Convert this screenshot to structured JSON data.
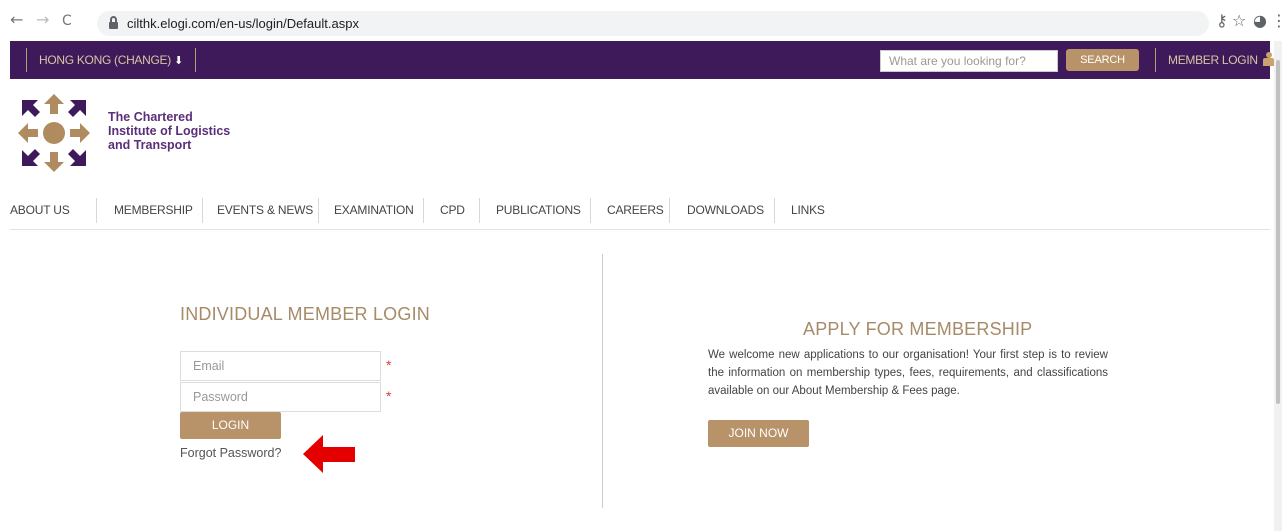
{
  "browser": {
    "url": "cilthk.elogi.com/en-us/login/Default.aspx",
    "back_icon": "←",
    "forward_icon": "→",
    "reload_icon": "C",
    "key_icon": "⚷",
    "star_icon": "☆",
    "profile_icon": "◕",
    "menu_icon": "⋮"
  },
  "topbar": {
    "region_label": "HONG KONG (CHANGE)",
    "region_arrow": "⬇",
    "search_placeholder": "What are you looking for?",
    "search_button": "SEARCH",
    "member_login": "MEMBER LOGIN"
  },
  "logo": {
    "line1": "The Chartered",
    "line2": "Institute of Logistics",
    "line3": "and Transport"
  },
  "nav": {
    "items": [
      "ABOUT US",
      "MEMBERSHIP",
      "EVENTS & NEWS",
      "EXAMINATION",
      "CPD",
      "PUBLICATIONS",
      "CAREERS",
      "DOWNLOADS",
      "LINKS"
    ]
  },
  "login": {
    "title": "INDIVIDUAL MEMBER LOGIN",
    "email_placeholder": "Email",
    "password_placeholder": "Password",
    "required_mark": "*",
    "login_button": "LOGIN",
    "forgot_link": "Forgot Password?"
  },
  "apply": {
    "title": "APPLY FOR MEMBERSHIP",
    "text": "We welcome new applications to our organisation! Your first step is to review the information on membership types, fees, requirements, and classifications available on our About Membership & Fees page.",
    "join_button": "JOIN NOW"
  },
  "colors": {
    "purple": "#3e1a5b",
    "gold": "#b89268",
    "arrow_red": "#e50000"
  }
}
